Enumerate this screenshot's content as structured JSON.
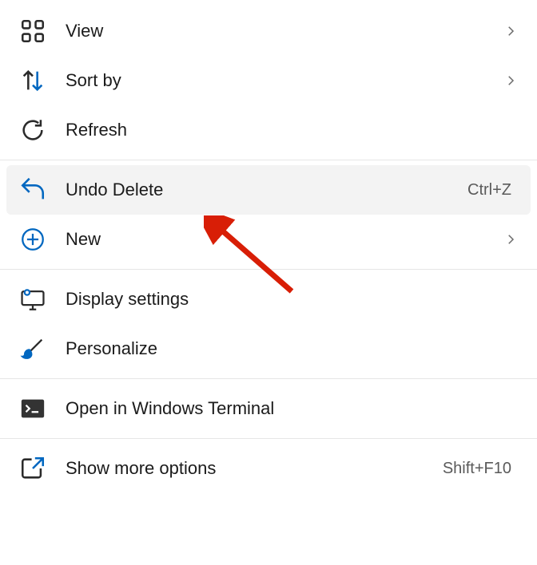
{
  "menu": {
    "items": [
      {
        "label": "View",
        "has_submenu": true,
        "shortcut": ""
      },
      {
        "label": "Sort by",
        "has_submenu": true,
        "shortcut": ""
      },
      {
        "label": "Refresh",
        "has_submenu": false,
        "shortcut": ""
      },
      {
        "label": "Undo Delete",
        "has_submenu": false,
        "shortcut": "Ctrl+Z",
        "highlighted": true
      },
      {
        "label": "New",
        "has_submenu": true,
        "shortcut": ""
      },
      {
        "label": "Display settings",
        "has_submenu": false,
        "shortcut": ""
      },
      {
        "label": "Personalize",
        "has_submenu": false,
        "shortcut": ""
      },
      {
        "label": "Open in Windows Terminal",
        "has_submenu": false,
        "shortcut": ""
      },
      {
        "label": "Show more options",
        "has_submenu": false,
        "shortcut": "Shift+F10"
      }
    ]
  },
  "icons": {
    "view": "grid-icon",
    "sort": "sort-icon",
    "refresh": "refresh-icon",
    "undo": "undo-icon",
    "new": "plus-circle-icon",
    "display": "monitor-gear-icon",
    "personalize": "brush-icon",
    "terminal": "terminal-icon",
    "more": "open-out-icon"
  },
  "colors": {
    "accent_blue": "#0067c0",
    "highlight_bg": "#f3f3f3",
    "text": "#1b1b1b",
    "shortcut_text": "#5a5a5a",
    "divider": "#e6e6e6",
    "annotation_red": "#d81e06"
  }
}
